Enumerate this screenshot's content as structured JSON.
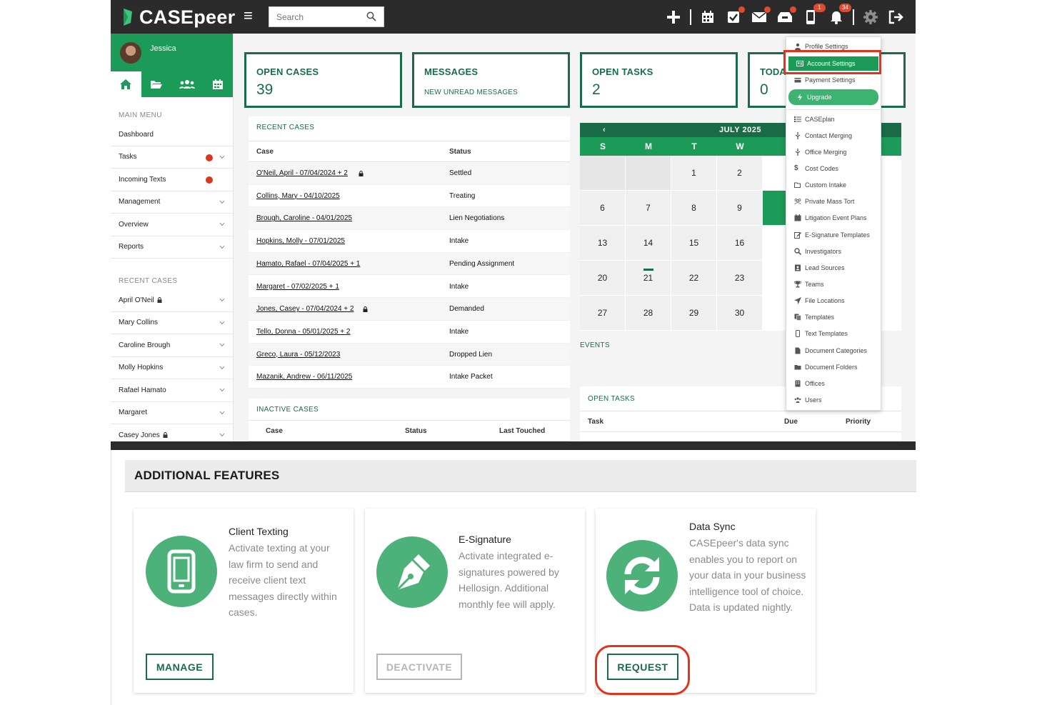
{
  "app": {
    "brand": "CASEpeer",
    "search_placeholder": "Search",
    "notif_count": "34"
  },
  "user": {
    "name": "Jessica"
  },
  "sidebar": {
    "main_menu_label": "MAIN MENU",
    "main_items": [
      "Dashboard",
      "Tasks",
      "Incoming Texts",
      "Management",
      "Overview",
      "Reports"
    ],
    "recent_label": "RECENT CASES",
    "recent_items": [
      "April O'Neil",
      "Mary Collins",
      "Caroline Brough",
      "Molly Hopkins",
      "Rafael Hamato",
      "Margaret",
      "Casey Jones"
    ]
  },
  "stats": {
    "open_cases_label": "OPEN CASES",
    "open_cases_value": "39",
    "messages_label": "MESSAGES",
    "messages_sub": "NEW UNREAD MESSAGES",
    "open_tasks_label": "OPEN TASKS",
    "open_tasks_value": "2",
    "today_label": "TODA",
    "today_value": "0"
  },
  "recent_cases": {
    "title": "RECENT CASES",
    "col_case": "Case",
    "col_status": "Status",
    "rows": [
      {
        "case": "O'Neil, April - 07/04/2024 + 2",
        "status": "Settled"
      },
      {
        "case": "Collins, Mary - 04/10/2025",
        "status": "Treating"
      },
      {
        "case": "Brough, Caroline - 04/01/2025",
        "status": "Lien Negotiations"
      },
      {
        "case": "Hopkins, Molly - 07/01/2025",
        "status": "Intake"
      },
      {
        "case": "Hamato, Rafael - 07/04/2025 + 1",
        "status": "Pending Assignment"
      },
      {
        "case": "Margaret - 07/02/2025 + 1",
        "status": "Intake"
      },
      {
        "case": "Jones, Casey - 07/04/2024 + 2",
        "status": "Demanded"
      },
      {
        "case": "Tello, Donna - 05/01/2025 + 2",
        "status": "Intake"
      },
      {
        "case": "Greco, Laura - 05/12/2023",
        "status": "Dropped Lien"
      },
      {
        "case": "Mazanik, Andrew - 06/11/2025",
        "status": "Intake Packet"
      }
    ]
  },
  "inactive_cases": {
    "title": "INACTIVE CASES",
    "col_case": "Case",
    "col_status": "Status",
    "col_last": "Last Touched"
  },
  "calendar": {
    "prev": "‹",
    "month": "JULY 2025",
    "days": [
      "S",
      "M",
      "T",
      "W"
    ],
    "weeks": [
      [
        "",
        "",
        "1",
        "2"
      ],
      [
        "6",
        "7",
        "8",
        "9"
      ],
      [
        "13",
        "14",
        "15",
        "16"
      ],
      [
        "20",
        "21",
        "22",
        "23"
      ],
      [
        "27",
        "28",
        "29",
        "30"
      ]
    ]
  },
  "events_label": "EVENTS",
  "open_tasks_panel": {
    "title": "OPEN TASKS",
    "col_task": "Task",
    "col_due": "Due",
    "col_priority": "Priority"
  },
  "settings_menu": {
    "items": [
      "Profile Settings",
      "Account Settings",
      "Payment Settings",
      "Upgrade",
      "CASEplan",
      "Contact Merging",
      "Office Merging",
      "Cost Codes",
      "Custom Intake",
      "Private Mass Tort",
      "Litigation Event Plans",
      "E-Signature Templates",
      "Investigators",
      "Lead Sources",
      "Teams",
      "File Locations",
      "Templates",
      "Text Templates",
      "Document Categories",
      "Document Folders",
      "Offices",
      "Users"
    ]
  },
  "features": {
    "header": "ADDITIONAL FEATURES",
    "cards": [
      {
        "title": "Client Texting",
        "desc": "Activate texting at your law firm to send and receive client text messages directly within cases.",
        "button": "MANAGE"
      },
      {
        "title": "E-Signature",
        "desc": "Activate integrated e-signatures powered by Hellosign. Additional monthly fee will apply.",
        "button": "DEACTIVATE"
      },
      {
        "title": "Data Sync",
        "desc": "CASEpeer's data sync enables you to report on your data in your business intelligence tool of choice. Data is updated nightly.",
        "button": "REQUEST"
      }
    ]
  },
  "colors": {
    "brand_green": "#1c9a58",
    "dark_green": "#1c6b48",
    "highlight_red": "#e0341c"
  }
}
